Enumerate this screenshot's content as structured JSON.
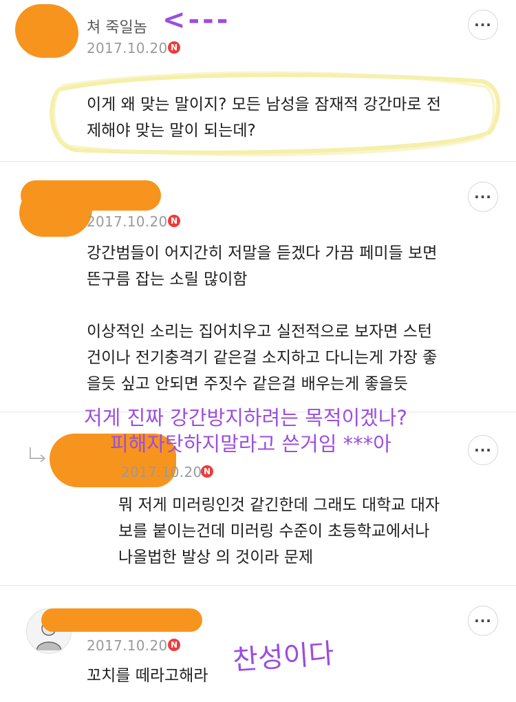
{
  "comments": [
    {
      "name": "쳐 죽일놈",
      "date": "2017.10.20",
      "badge": "N",
      "lines": [
        "이게 왜 맞는 말이지? 모든 남성을 잠재적 강간마로 전",
        "제해야 맞는 말이 되는데?"
      ]
    },
    {
      "date": "2017.10.20",
      "badge": "N",
      "lines": [
        "강간범들이 어지간히 저말을 듣겠다 가끔 페미들 보면",
        "뜬구름 잡는 소릴 많이함",
        "",
        "이상적인 소리는 집어치우고 실전적으로 보자면 스턴",
        "건이나 전기충격기 같은걸 소지하고 다니는게 가장 좋",
        "을듯 싶고 안되면 주짓수 같은걸 배우는게 좋을듯"
      ]
    },
    {
      "date": "2017.10.20",
      "badge": "N",
      "lines": [
        " 뭐 저게 미러링인것 같긴한데 그래도 대학교 대자",
        "보를 붙이는건데 미러링 수준이 초등학교에서나",
        "나올법한 발상 의 것이라 문제"
      ]
    },
    {
      "date": "2017.10.20",
      "badge": "N",
      "lines": [
        "꼬치를 떼라고해라"
      ]
    }
  ],
  "more_label": "···",
  "annotations": {
    "arrow": "<---",
    "note_line1": "저게 진짜 강간방지하려는 목적이겠나?",
    "note_line2": "피해자탓하지말라고 쓴거임 ***아",
    "agree": "찬성이다"
  },
  "colors": {
    "redaction": "#f7941d",
    "annotation": "#9b4ee0",
    "highlight": "#f3ec9a",
    "badge": "#ee3b3b"
  },
  "icons": [
    "more-icon",
    "reply-arrow-icon",
    "n-badge-icon",
    "avatar-icon"
  ]
}
